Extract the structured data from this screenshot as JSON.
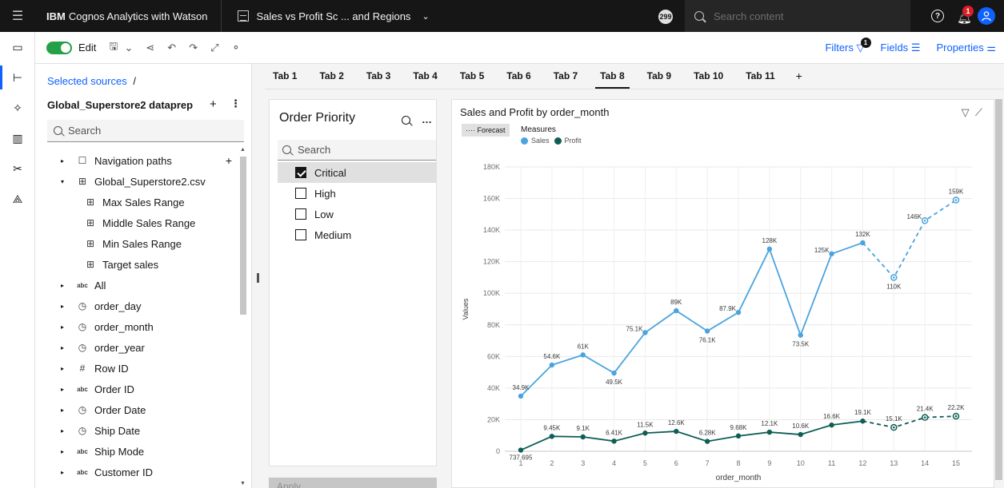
{
  "topbar": {
    "product_brand": "IBM",
    "product_name": "Cognos Analytics with Watson",
    "report_title": "Sales vs Profit Sc ... and Regions",
    "badge": "299",
    "search_placeholder": "Search content",
    "notifications": "1"
  },
  "toolbar": {
    "edit_label": "Edit",
    "filters_label": "Filters",
    "filters_count": "1",
    "fields_label": "Fields",
    "properties_label": "Properties"
  },
  "datapanel": {
    "breadcrumb": "Selected sources",
    "source_name": "Global_Superstore2 dataprep",
    "search_placeholder": "Search",
    "tree": [
      {
        "label": "Navigation paths",
        "icon": "folder-icon",
        "glyph": "☐",
        "level": 1,
        "twisty": "▸",
        "plus": "+"
      },
      {
        "label": "Global_Superstore2.csv",
        "icon": "table-icon",
        "glyph": "⊞",
        "level": 1,
        "twisty": "▾"
      },
      {
        "label": "Max Sales Range",
        "icon": "table-icon",
        "glyph": "⊞",
        "level": 2,
        "twisty": ""
      },
      {
        "label": "Middle Sales Range",
        "icon": "table-icon",
        "glyph": "⊞",
        "level": 2,
        "twisty": ""
      },
      {
        "label": "Min Sales Range",
        "icon": "table-icon",
        "glyph": "⊞",
        "level": 2,
        "twisty": ""
      },
      {
        "label": "Target sales",
        "icon": "table-icon",
        "glyph": "⊞",
        "level": 2,
        "twisty": ""
      },
      {
        "label": "All",
        "icon": "abc-icon",
        "glyph": "abc",
        "level": 1,
        "twisty": "▸"
      },
      {
        "label": "order_day",
        "icon": "clock-icon",
        "glyph": "◷",
        "level": 1,
        "twisty": "▸"
      },
      {
        "label": "order_month",
        "icon": "clock-icon",
        "glyph": "◷",
        "level": 1,
        "twisty": "▸"
      },
      {
        "label": "order_year",
        "icon": "clock-icon",
        "glyph": "◷",
        "level": 1,
        "twisty": "▸"
      },
      {
        "label": "Row ID",
        "icon": "hash-icon",
        "glyph": "#",
        "level": 1,
        "twisty": "▸"
      },
      {
        "label": "Order ID",
        "icon": "abc-icon",
        "glyph": "abc",
        "level": 1,
        "twisty": "▸"
      },
      {
        "label": "Order Date",
        "icon": "clock-icon",
        "glyph": "◷",
        "level": 1,
        "twisty": "▸"
      },
      {
        "label": "Ship Date",
        "icon": "clock-icon",
        "glyph": "◷",
        "level": 1,
        "twisty": "▸"
      },
      {
        "label": "Ship Mode",
        "icon": "abc-icon",
        "glyph": "abc",
        "level": 1,
        "twisty": "▸"
      },
      {
        "label": "Customer ID",
        "icon": "abc-icon",
        "glyph": "abc",
        "level": 1,
        "twisty": "▸"
      }
    ]
  },
  "tabs": [
    "Tab 1",
    "Tab 2",
    "Tab 3",
    "Tab 4",
    "Tab 5",
    "Tab 6",
    "Tab 7",
    "Tab 8",
    "Tab 9",
    "Tab 10",
    "Tab 11"
  ],
  "active_tab": "Tab 8",
  "filter_widget": {
    "title": "Order Priority",
    "search_placeholder": "Search",
    "items": [
      {
        "label": "Critical",
        "checked": true
      },
      {
        "label": "High",
        "checked": false
      },
      {
        "label": "Low",
        "checked": false
      },
      {
        "label": "Medium",
        "checked": false
      }
    ],
    "apply_label": "Apply"
  },
  "colors": {
    "sales": "#4aa3df",
    "profit": "#0f5e56",
    "accent": "#0f62fe"
  },
  "chart_data": {
    "type": "line",
    "title": "Sales and Profit by order_month",
    "forecast_label": "Forecast",
    "legend_title": "Measures",
    "xlabel": "order_month",
    "ylabel": "Values",
    "x": [
      1,
      2,
      3,
      4,
      5,
      6,
      7,
      8,
      9,
      10,
      11,
      12,
      13,
      14,
      15
    ],
    "forecast_from": 12,
    "ylim": [
      0,
      180000
    ],
    "yticks": [
      "0",
      "20K",
      "40K",
      "60K",
      "80K",
      "100K",
      "120K",
      "140K",
      "160K",
      "180K"
    ],
    "series": [
      {
        "name": "Sales",
        "values": [
          34900,
          54600,
          61000,
          49500,
          75100,
          89000,
          76100,
          87900,
          128000,
          73500,
          125000,
          132000,
          110000,
          146000,
          159000
        ],
        "labels": [
          "34.9K",
          "54.6K",
          "61K",
          "49.5K",
          "75.1K",
          "89K",
          "76.1K",
          "87.9K",
          "128K",
          "73.5K",
          "125K",
          "132K",
          "110K",
          "146K",
          "159K"
        ]
      },
      {
        "name": "Profit",
        "values": [
          737.695,
          9450,
          9100,
          6410,
          11500,
          12600,
          6280,
          9680,
          12100,
          10600,
          16600,
          19100,
          15100,
          21400,
          22200
        ],
        "labels": [
          "737.695",
          "9.45K",
          "9.1K",
          "6.41K",
          "11.5K",
          "12.6K",
          "6.28K",
          "9.68K",
          "12.1K",
          "10.6K",
          "16.6K",
          "19.1K",
          "15.1K",
          "21.4K",
          "22.2K"
        ]
      }
    ],
    "grid": true,
    "legend_position": "top-left"
  }
}
